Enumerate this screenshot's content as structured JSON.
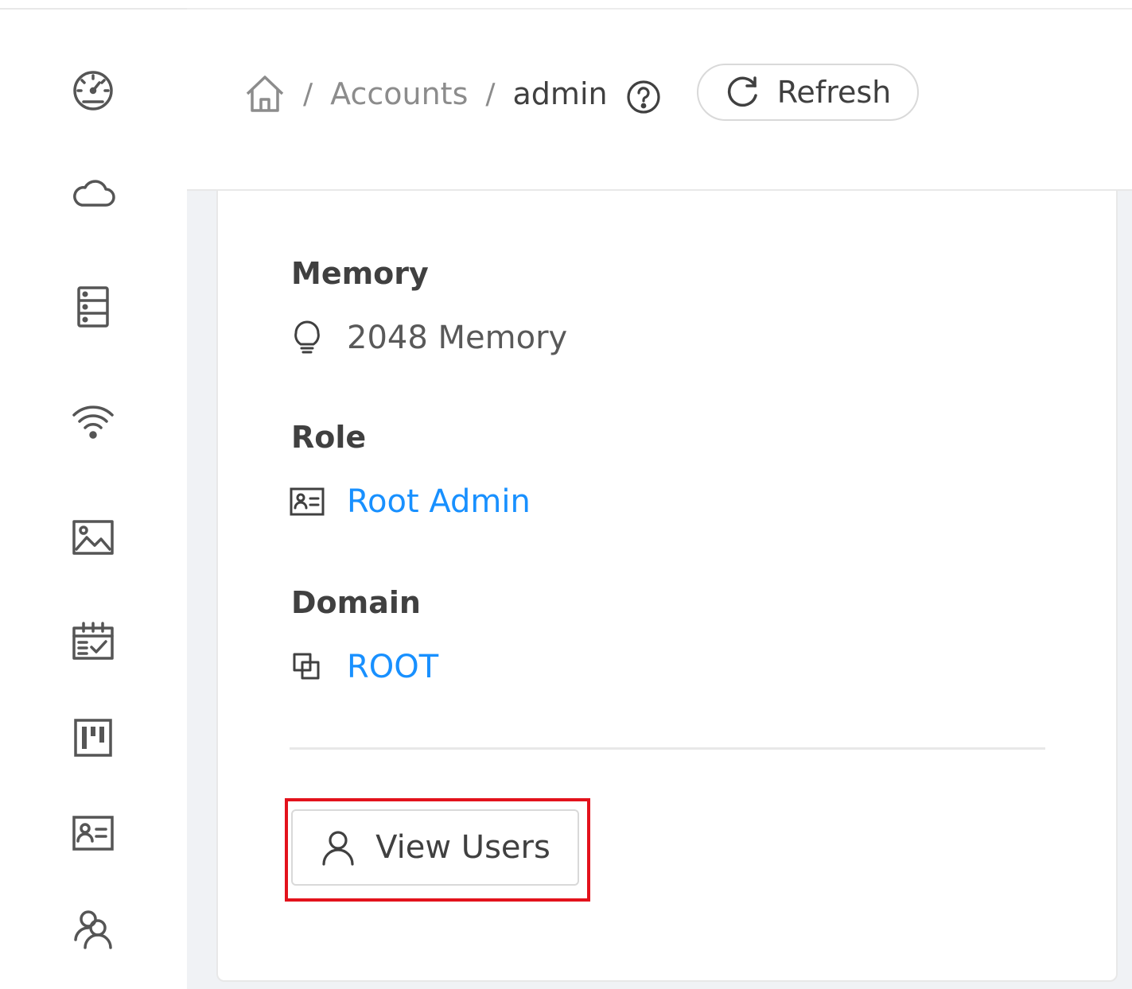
{
  "sidebar": {
    "items": [
      {
        "icon": "dashboard-icon"
      },
      {
        "icon": "cloud-icon"
      },
      {
        "icon": "storage-icon"
      },
      {
        "icon": "wifi-icon"
      },
      {
        "icon": "image-icon"
      },
      {
        "icon": "calendar-check-icon"
      },
      {
        "icon": "project-icon"
      },
      {
        "icon": "idcard-icon"
      },
      {
        "icon": "team-icon"
      }
    ]
  },
  "header": {
    "breadcrumb": {
      "home_icon": "home-icon",
      "separator": "/",
      "accounts": "Accounts",
      "current": "admin",
      "help_icon": "question-circle-icon"
    },
    "refresh_label": "Refresh"
  },
  "details": {
    "memory": {
      "title": "Memory",
      "value": "2048 Memory",
      "icon": "bulb-icon"
    },
    "role": {
      "title": "Role",
      "value": "Root Admin",
      "icon": "idcard-icon"
    },
    "domain": {
      "title": "Domain",
      "value": "ROOT",
      "icon": "block-icon"
    }
  },
  "actions": {
    "view_users_label": "View Users",
    "view_users_icon": "user-icon"
  },
  "colors": {
    "link": "#1890ff",
    "highlight": "#e3121c",
    "text": "#404040",
    "muted": "#8c8c8c"
  }
}
